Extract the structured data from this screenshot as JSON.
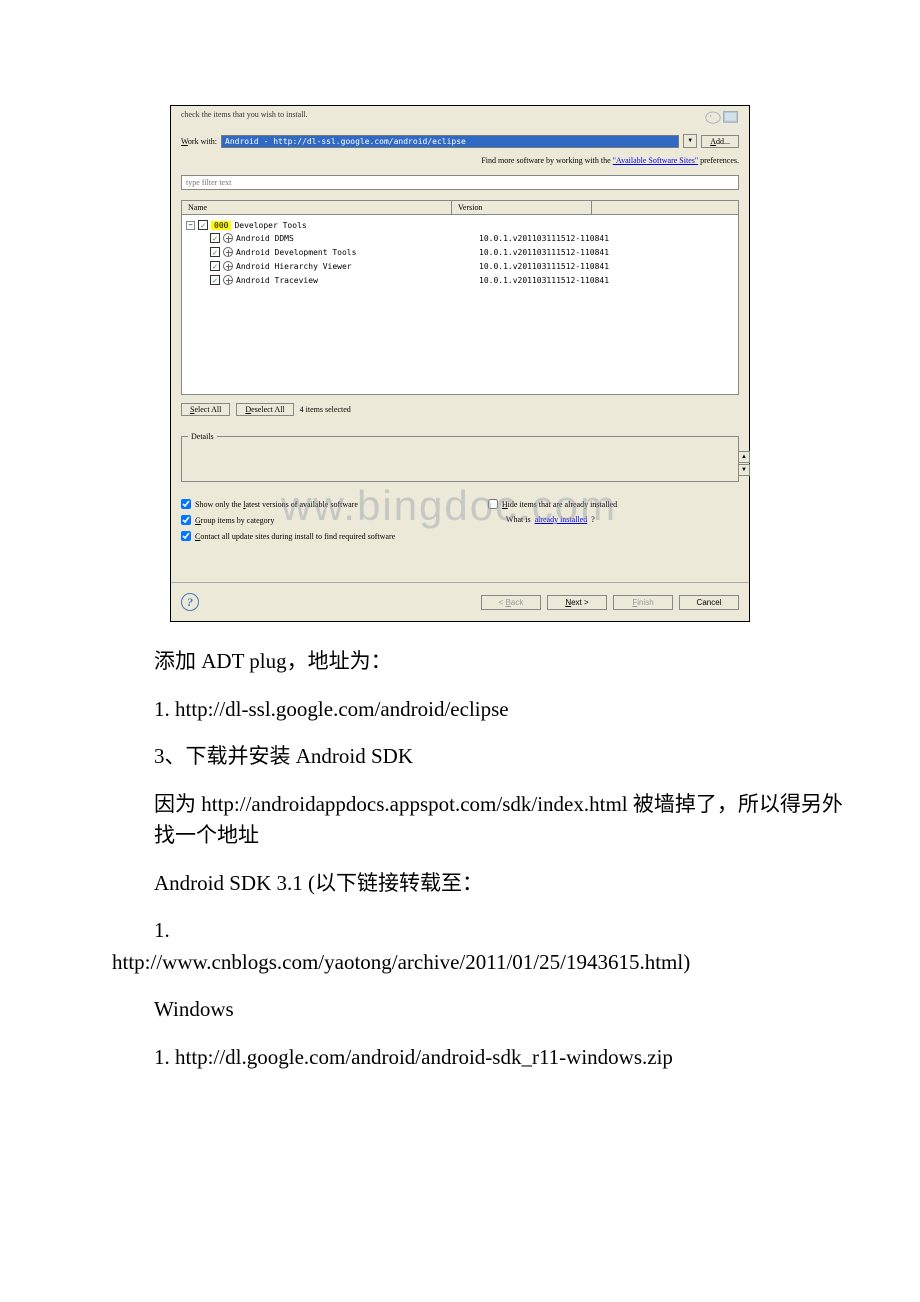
{
  "dialog": {
    "header_text": "check the items that you wish to install.",
    "work_with_label": "Work with:",
    "work_with_value": "Android - http://dl-ssl.google.com/android/eclipse",
    "add_button": "Add...",
    "hint_prefix": "Find more software by working with the ",
    "hint_link": "\"Available Software Sites\"",
    "hint_suffix": " preferences.",
    "filter_placeholder": "type filter text",
    "columns": {
      "name": "Name",
      "version": "Version"
    },
    "parent_label": "Developer Tools",
    "items": [
      {
        "name": "Android DDMS",
        "version": "10.0.1.v201103111512-110841"
      },
      {
        "name": "Android Development Tools",
        "version": "10.0.1.v201103111512-110841"
      },
      {
        "name": "Android Hierarchy Viewer",
        "version": "10.0.1.v201103111512-110841"
      },
      {
        "name": "Android Traceview",
        "version": "10.0.1.v201103111512-110841"
      }
    ],
    "select_all": "Select All",
    "deselect_all": "Deselect All",
    "items_selected": "4 items selected",
    "details_label": "Details",
    "opt_latest": "Show only the latest versions of available software",
    "opt_group": "Group items by category",
    "opt_contact": "Contact all update sites during install to find required software",
    "opt_hide": "Hide items that are already installed",
    "already_prefix": "What is ",
    "already_link": "already installed",
    "already_suffix": "?",
    "back": "< Back",
    "next": "Next >",
    "finish": "Finish",
    "cancel": "Cancel",
    "watermark": "ww.bingdoc.com"
  },
  "article": {
    "p1": "添加 ADT plug，地址为：",
    "p2": "1. http://dl-ssl.google.com/android/eclipse",
    "p3": "3、下载并安装 Android SDK",
    "p4": "因为 http://androidappdocs.appspot.com/sdk/index.html 被墙掉了，所以得另外找一个地址",
    "p5": "Android SDK 3.1 (以下链接转载至：",
    "p6a": "1.",
    "p6b": "http://www.cnblogs.com/yaotong/archive/2011/01/25/1943615.html)",
    "p7": "Windows",
    "p8": "1. http://dl.google.com/android/android-sdk_r11-windows.zip"
  }
}
